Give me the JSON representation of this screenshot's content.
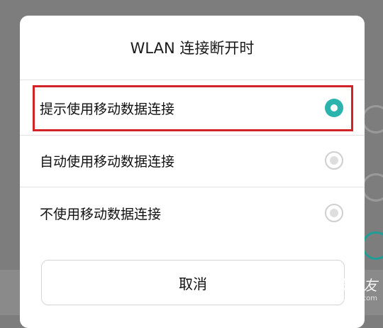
{
  "dialog": {
    "title": "WLAN 连接断开时",
    "options": [
      {
        "label": "提示使用移动数据连接",
        "selected": true
      },
      {
        "label": "自动使用移动数据连接",
        "selected": false
      },
      {
        "label": "不使用移动数据连接",
        "selected": false
      }
    ],
    "cancel_label": "取消"
  },
  "watermark": {
    "text": "电子发烧友",
    "sub": "www.elecfans.com"
  },
  "colors": {
    "accent": "#2bb3ad",
    "highlight": "#d2232a"
  }
}
